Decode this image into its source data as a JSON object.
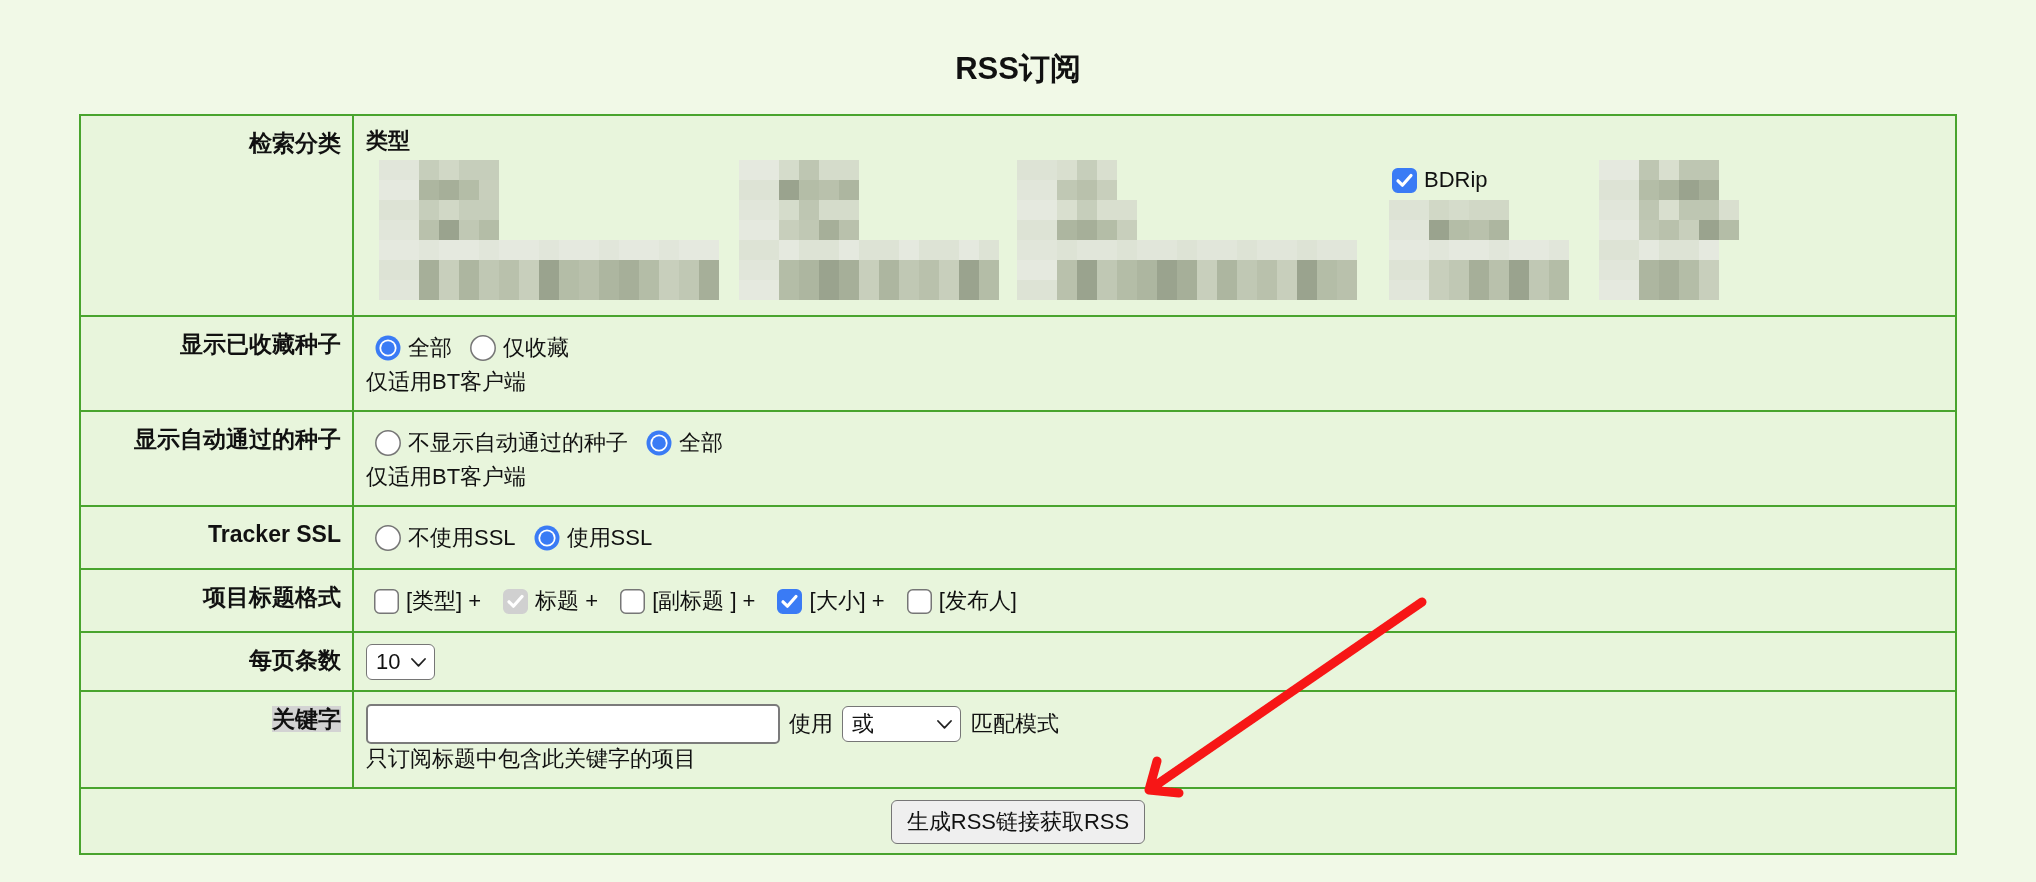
{
  "title": "RSS订阅",
  "rows": [
    {
      "kind": "categories",
      "label": "检索分类",
      "highlighted": false,
      "heading": "类型",
      "items": [
        {
          "kind": "redacted"
        },
        {
          "kind": "redacted"
        },
        {
          "kind": "redacted"
        },
        {
          "kind": "checkbox",
          "label": "BDRip",
          "checked": true
        },
        {
          "kind": "redacted"
        },
        {
          "kind": "redacted"
        },
        {
          "kind": "redacted"
        },
        {
          "kind": "redacted"
        },
        {
          "kind": "redacted"
        },
        {
          "kind": "redacted"
        },
        {
          "kind": "redacted"
        },
        {
          "kind": "redacted"
        },
        {
          "kind": "redacted"
        },
        {
          "kind": "redacted"
        },
        {
          "kind": "redacted"
        }
      ]
    },
    {
      "kind": "radios",
      "label": "显示已收藏种子",
      "highlighted": false,
      "options": [
        {
          "label": "全部",
          "selected": true
        },
        {
          "label": "仅收藏",
          "selected": false
        }
      ],
      "note": "仅适用BT客户端"
    },
    {
      "kind": "radios",
      "label": "显示自动通过的种子",
      "highlighted": false,
      "options": [
        {
          "label": "不显示自动通过的种子",
          "selected": false
        },
        {
          "label": "全部",
          "selected": true
        }
      ],
      "note": "仅适用BT客户端"
    },
    {
      "kind": "radios",
      "label": "Tracker SSL",
      "highlighted": false,
      "options": [
        {
          "label": "不使用SSL",
          "selected": false
        },
        {
          "label": "使用SSL",
          "selected": true
        }
      ]
    },
    {
      "kind": "checkboxes",
      "label": "项目标题格式",
      "highlighted": false,
      "options": [
        {
          "label": "[类型] +",
          "checked": false,
          "disabled": false
        },
        {
          "label": "标题 +",
          "checked": true,
          "disabled": true
        },
        {
          "label": "[副标题 ] +",
          "checked": false,
          "disabled": false
        },
        {
          "label": "[大小] +",
          "checked": true,
          "disabled": false
        },
        {
          "label": "[发布人]",
          "checked": false,
          "disabled": false
        }
      ]
    },
    {
      "kind": "select",
      "label": "每页条数",
      "highlighted": false,
      "value": "10"
    },
    {
      "kind": "keyword",
      "label": "关键字",
      "highlighted": true,
      "match_label": "使用",
      "match_value": "或",
      "match_suffix": "匹配模式",
      "note": "只订阅标题中包含此关键字的项目"
    }
  ],
  "submit_button": "生成RSS链接获取RSS"
}
